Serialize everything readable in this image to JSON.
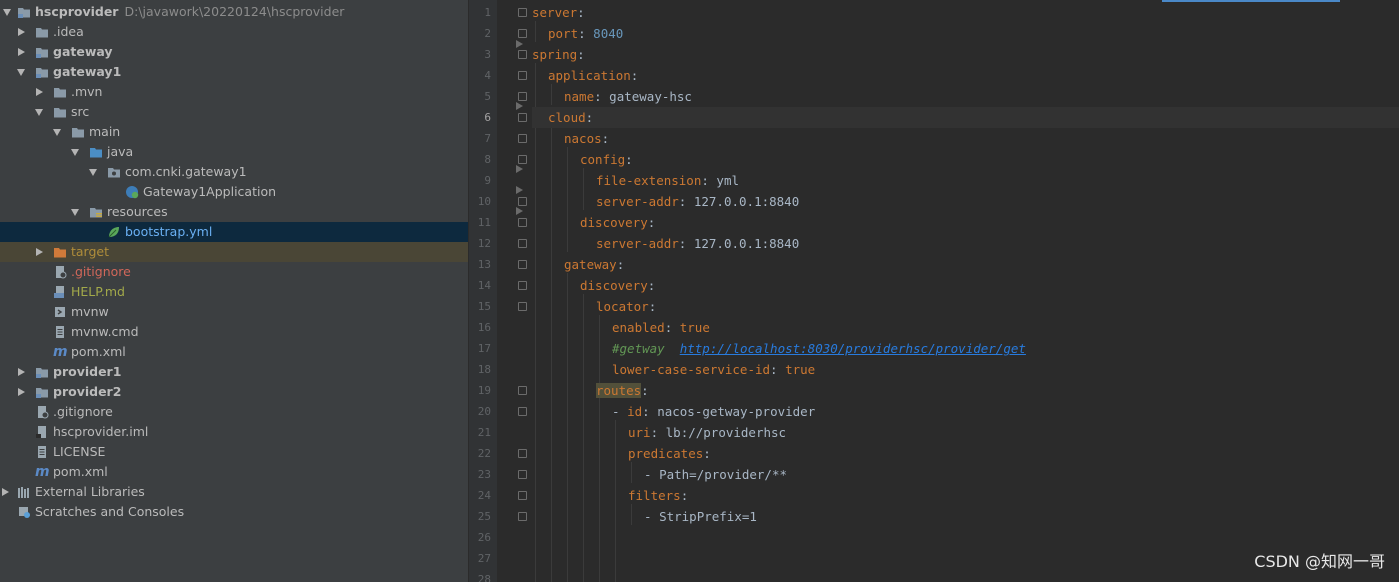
{
  "tree": {
    "root": {
      "name": "hscprovider",
      "path": "D:\\javawork\\20220124\\hscprovider"
    },
    "items": [
      {
        "label": ".idea"
      },
      {
        "label": "gateway"
      },
      {
        "label": "gateway1"
      },
      {
        "label": ".mvn"
      },
      {
        "label": "src"
      },
      {
        "label": "main"
      },
      {
        "label": "java"
      },
      {
        "label": "com.cnki.gateway1"
      },
      {
        "label": "Gateway1Application"
      },
      {
        "label": "resources"
      },
      {
        "label": "bootstrap.yml"
      },
      {
        "label": "target"
      },
      {
        "label": ".gitignore"
      },
      {
        "label": "HELP.md"
      },
      {
        "label": "mvnw"
      },
      {
        "label": "mvnw.cmd"
      },
      {
        "label": "pom.xml"
      },
      {
        "label": "provider1"
      },
      {
        "label": "provider2"
      },
      {
        "label": ".gitignore"
      },
      {
        "label": "hscprovider.iml"
      },
      {
        "label": "LICENSE"
      },
      {
        "label": "pom.xml"
      },
      {
        "label": "External Libraries"
      },
      {
        "label": "Scratches and Consoles"
      }
    ]
  },
  "editor": {
    "current_line": 6,
    "lines": [
      {
        "num": "1",
        "key": "server",
        "sep": ":",
        "val": ""
      },
      {
        "num": "2",
        "key": "port",
        "sep": ": ",
        "val": "8040"
      },
      {
        "num": "3",
        "key": "spring",
        "sep": ":",
        "val": ""
      },
      {
        "num": "4",
        "key": "application",
        "sep": ":",
        "val": ""
      },
      {
        "num": "5",
        "key": "name",
        "sep": ": ",
        "val": "gateway-hsc"
      },
      {
        "num": "6",
        "key": "cloud",
        "sep": ":",
        "val": ""
      },
      {
        "num": "7",
        "key": "nacos",
        "sep": ":",
        "val": ""
      },
      {
        "num": "8",
        "key": "config",
        "sep": ":",
        "val": ""
      },
      {
        "num": "9",
        "key": "file-extension",
        "sep": ": ",
        "val": "yml"
      },
      {
        "num": "10",
        "key": "server-addr",
        "sep": ": ",
        "val": "127.0.0.1:8840"
      },
      {
        "num": "11",
        "key": "discovery",
        "sep": ":",
        "val": ""
      },
      {
        "num": "12",
        "key": "server-addr",
        "sep": ": ",
        "val": "127.0.0.1:8840"
      },
      {
        "num": "13",
        "key": "gateway",
        "sep": ":",
        "val": ""
      },
      {
        "num": "14",
        "key": "discovery",
        "sep": ":",
        "val": ""
      },
      {
        "num": "15",
        "key": "locator",
        "sep": ":",
        "val": ""
      },
      {
        "num": "16",
        "key": "enabled",
        "sep": ": ",
        "val": "true"
      },
      {
        "num": "17",
        "comment": "#getway  ",
        "url": "http://localhost:8030/providerhsc/provider/get"
      },
      {
        "num": "18",
        "key": "lower-case-service-id",
        "sep": ": ",
        "val": "true"
      },
      {
        "num": "19",
        "key": "routes",
        "sep": ":",
        "val": ""
      },
      {
        "num": "20",
        "dash": "- ",
        "key": "id",
        "sep": ": ",
        "val": "nacos-getway-provider"
      },
      {
        "num": "21",
        "key": "uri",
        "sep": ": ",
        "val": "lb://providerhsc"
      },
      {
        "num": "22",
        "key": "predicates",
        "sep": ":",
        "val": ""
      },
      {
        "num": "23",
        "dash": "- ",
        "val": "Path=/provider/**"
      },
      {
        "num": "24",
        "key": "filters",
        "sep": ":",
        "val": ""
      },
      {
        "num": "25",
        "dash": "- ",
        "val": "StripPrefix=1"
      },
      {
        "num": "26"
      },
      {
        "num": "27"
      },
      {
        "num": "28"
      }
    ]
  },
  "watermark": "CSDN @知网一哥",
  "colors": {
    "key": "#cc7832",
    "number": "#6897bb",
    "comment": "#629755",
    "url": "#287bde",
    "selection": "#0d293e"
  }
}
